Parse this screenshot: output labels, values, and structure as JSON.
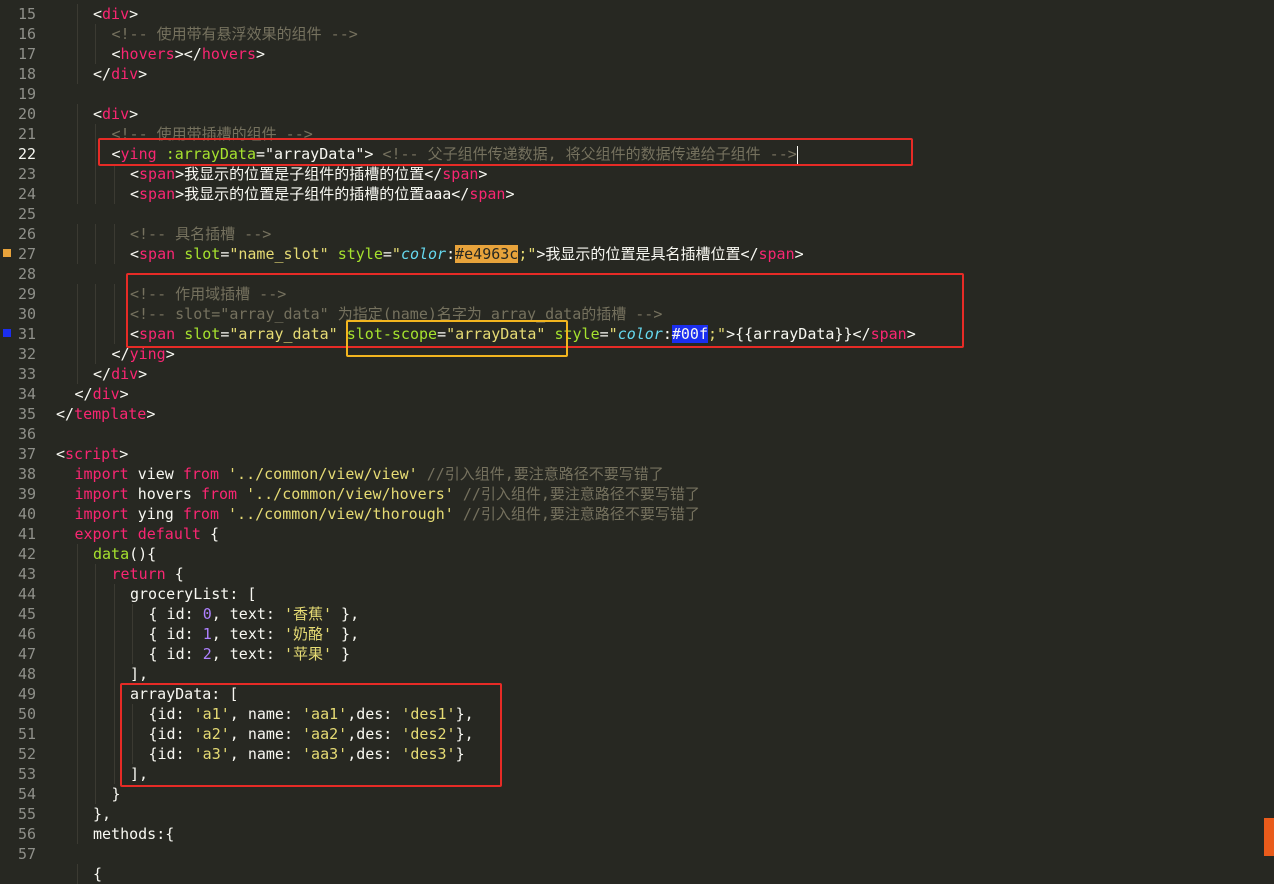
{
  "editor": {
    "active_line": "22",
    "lines": [
      {
        "n": "15",
        "indent": 2,
        "tokens": [
          [
            "<",
            "t-default"
          ],
          [
            "div",
            "t-tag"
          ],
          [
            ">",
            "t-default"
          ]
        ]
      },
      {
        "n": "16",
        "indent": 3,
        "tokens": [
          [
            "<!-- 使用带有悬浮效果的组件 -->",
            "t-com"
          ]
        ]
      },
      {
        "n": "17",
        "indent": 3,
        "tokens": [
          [
            "<",
            "t-default"
          ],
          [
            "hovers",
            "t-tag"
          ],
          [
            "></",
            "t-default"
          ],
          [
            "hovers",
            "t-tag"
          ],
          [
            ">",
            "t-default"
          ]
        ]
      },
      {
        "n": "18",
        "indent": 2,
        "tokens": [
          [
            "</",
            "t-default"
          ],
          [
            "div",
            "t-tag"
          ],
          [
            ">",
            "t-default"
          ]
        ]
      },
      {
        "n": "19",
        "indent": 0,
        "tokens": []
      },
      {
        "n": "20",
        "indent": 2,
        "tokens": [
          [
            "<",
            "t-default"
          ],
          [
            "div",
            "t-tag"
          ],
          [
            ">",
            "t-default"
          ]
        ]
      },
      {
        "n": "21",
        "indent": 3,
        "tokens": [
          [
            "<!-- 使用带插槽的组件 -->",
            "t-com"
          ]
        ]
      },
      {
        "n": "22",
        "indent": 3,
        "tokens": [
          [
            "<",
            "t-default"
          ],
          [
            "ying",
            "t-tag"
          ],
          [
            " ",
            "t-default"
          ],
          [
            ":arrayData",
            "t-attr"
          ],
          [
            "=",
            "t-default"
          ],
          [
            "\"arrayData\"",
            "t-default"
          ],
          [
            "> ",
            "t-default"
          ],
          [
            "<!-- 父子组件传递数据, 将父组件的数据传递给子组件 -->",
            "t-com"
          ],
          [
            "",
            "cursor"
          ]
        ]
      },
      {
        "n": "23",
        "indent": 4,
        "tokens": [
          [
            "<",
            "t-default"
          ],
          [
            "span",
            "t-tag"
          ],
          [
            ">我显示的位置是子组件的插槽的位置</",
            "t-default"
          ],
          [
            "span",
            "t-tag"
          ],
          [
            ">",
            "t-default"
          ]
        ]
      },
      {
        "n": "24",
        "indent": 4,
        "tokens": [
          [
            "<",
            "t-default"
          ],
          [
            "span",
            "t-tag"
          ],
          [
            ">我显示的位置是子组件的插槽的位置aaa</",
            "t-default"
          ],
          [
            "span",
            "t-tag"
          ],
          [
            ">",
            "t-default"
          ]
        ]
      },
      {
        "n": "25",
        "indent": 0,
        "tokens": []
      },
      {
        "n": "26",
        "indent": 4,
        "tokens": [
          [
            "<!-- 具名插槽 -->",
            "t-com"
          ]
        ]
      },
      {
        "n": "27",
        "indent": 4,
        "tokens": [
          [
            "<",
            "t-default"
          ],
          [
            "span",
            "t-tag"
          ],
          [
            " ",
            "t-default"
          ],
          [
            "slot",
            "t-attr"
          ],
          [
            "=",
            "t-default"
          ],
          [
            "\"name_slot\"",
            "t-str"
          ],
          [
            " ",
            "t-default"
          ],
          [
            "style",
            "t-attr"
          ],
          [
            "=",
            "t-default"
          ],
          [
            "\"",
            "t-str"
          ],
          [
            "color",
            "t-cssprop"
          ],
          [
            ":",
            "t-default"
          ],
          [
            "#e4963c",
            "hl-orange"
          ],
          [
            ";\"",
            "t-str"
          ],
          [
            ">我显示的位置是具名插槽位置</",
            "t-default"
          ],
          [
            "span",
            "t-tag"
          ],
          [
            ">",
            "t-default"
          ]
        ]
      },
      {
        "n": "28",
        "indent": 0,
        "tokens": []
      },
      {
        "n": "29",
        "indent": 4,
        "tokens": [
          [
            "<!-- 作用域插槽 -->",
            "t-com"
          ]
        ]
      },
      {
        "n": "30",
        "indent": 4,
        "tokens": [
          [
            "<!-- slot=\"array_data\" 为指定(name)名字为 array_data的插槽 -->",
            "t-com"
          ]
        ]
      },
      {
        "n": "31",
        "indent": 4,
        "tokens": [
          [
            "<",
            "t-default"
          ],
          [
            "span",
            "t-tag"
          ],
          [
            " ",
            "t-default"
          ],
          [
            "slot",
            "t-attr"
          ],
          [
            "=",
            "t-default"
          ],
          [
            "\"array_data\"",
            "t-str"
          ],
          [
            " ",
            "t-default"
          ],
          [
            "slot-scope",
            "t-attr"
          ],
          [
            "=",
            "t-default"
          ],
          [
            "\"arrayData\"",
            "t-str"
          ],
          [
            " ",
            "t-default"
          ],
          [
            "style",
            "t-attr"
          ],
          [
            "=",
            "t-default"
          ],
          [
            "\"",
            "t-str"
          ],
          [
            "color",
            "t-cssprop"
          ],
          [
            ":",
            "t-default"
          ],
          [
            "#00f",
            "hl-blue"
          ],
          [
            ";\"",
            "t-str"
          ],
          [
            ">{{arrayData}}</",
            "t-default"
          ],
          [
            "span",
            "t-tag"
          ],
          [
            ">",
            "t-default"
          ]
        ]
      },
      {
        "n": "32",
        "indent": 3,
        "tokens": [
          [
            "</",
            "t-default"
          ],
          [
            "ying",
            "t-tag"
          ],
          [
            ">",
            "t-default"
          ]
        ]
      },
      {
        "n": "33",
        "indent": 2,
        "tokens": [
          [
            "</",
            "t-default"
          ],
          [
            "div",
            "t-tag"
          ],
          [
            ">",
            "t-default"
          ]
        ]
      },
      {
        "n": "34",
        "indent": 1,
        "tokens": [
          [
            "</",
            "t-default"
          ],
          [
            "div",
            "t-tag"
          ],
          [
            ">",
            "t-default"
          ]
        ]
      },
      {
        "n": "35",
        "indent": 0,
        "tokens": [
          [
            "</",
            "t-default"
          ],
          [
            "template",
            "t-tag"
          ],
          [
            ">",
            "t-default"
          ]
        ]
      },
      {
        "n": "36",
        "indent": 0,
        "tokens": []
      },
      {
        "n": "37",
        "indent": 0,
        "tokens": [
          [
            "<",
            "t-default"
          ],
          [
            "script",
            "t-tag"
          ],
          [
            ">",
            "t-default"
          ]
        ]
      },
      {
        "n": "38",
        "indent": 1,
        "tokens": [
          [
            "import",
            "t-kw"
          ],
          [
            " view ",
            "t-default"
          ],
          [
            "from",
            "t-kw"
          ],
          [
            " ",
            "t-default"
          ],
          [
            "'../common/view/view'",
            "t-str"
          ],
          [
            " //引入组件,要注意路径不要写错了",
            "t-com"
          ]
        ]
      },
      {
        "n": "39",
        "indent": 1,
        "tokens": [
          [
            "import",
            "t-kw"
          ],
          [
            " hovers ",
            "t-default"
          ],
          [
            "from",
            "t-kw"
          ],
          [
            " ",
            "t-default"
          ],
          [
            "'../common/view/hovers'",
            "t-str"
          ],
          [
            " //引入组件,要注意路径不要写错了",
            "t-com"
          ]
        ]
      },
      {
        "n": "40",
        "indent": 1,
        "tokens": [
          [
            "import",
            "t-kw"
          ],
          [
            " ying ",
            "t-default"
          ],
          [
            "from",
            "t-kw"
          ],
          [
            " ",
            "t-default"
          ],
          [
            "'../common/view/thorough'",
            "t-str"
          ],
          [
            " //引入组件,要注意路径不要写错了",
            "t-com"
          ]
        ]
      },
      {
        "n": "41",
        "indent": 1,
        "tokens": [
          [
            "export",
            "t-kw"
          ],
          [
            " ",
            "t-default"
          ],
          [
            "default",
            "t-kw"
          ],
          [
            " {",
            "t-default"
          ]
        ]
      },
      {
        "n": "42",
        "indent": 2,
        "tokens": [
          [
            "data",
            "t-fn"
          ],
          [
            "(){",
            "t-default"
          ]
        ]
      },
      {
        "n": "43",
        "indent": 3,
        "tokens": [
          [
            "return",
            "t-kw"
          ],
          [
            " {",
            "t-default"
          ]
        ]
      },
      {
        "n": "44",
        "indent": 4,
        "tokens": [
          [
            "groceryList: [",
            "t-default"
          ]
        ]
      },
      {
        "n": "45",
        "indent": 5,
        "tokens": [
          [
            "{ id: ",
            "t-default"
          ],
          [
            "0",
            "t-num"
          ],
          [
            ", text: ",
            "t-default"
          ],
          [
            "'香蕉'",
            "t-str"
          ],
          [
            " },",
            "t-default"
          ]
        ]
      },
      {
        "n": "46",
        "indent": 5,
        "tokens": [
          [
            "{ id: ",
            "t-default"
          ],
          [
            "1",
            "t-num"
          ],
          [
            ", text: ",
            "t-default"
          ],
          [
            "'奶酪'",
            "t-str"
          ],
          [
            " },",
            "t-default"
          ]
        ]
      },
      {
        "n": "47",
        "indent": 5,
        "tokens": [
          [
            "{ id: ",
            "t-default"
          ],
          [
            "2",
            "t-num"
          ],
          [
            ", text: ",
            "t-default"
          ],
          [
            "'苹果'",
            "t-str"
          ],
          [
            " }",
            "t-default"
          ]
        ]
      },
      {
        "n": "48",
        "indent": 4,
        "tokens": [
          [
            "],",
            "t-default"
          ]
        ]
      },
      {
        "n": "49",
        "indent": 4,
        "tokens": [
          [
            "arrayData: [",
            "t-default"
          ]
        ]
      },
      {
        "n": "50",
        "indent": 5,
        "tokens": [
          [
            "{id: ",
            "t-default"
          ],
          [
            "'a1'",
            "t-str"
          ],
          [
            ", name: ",
            "t-default"
          ],
          [
            "'aa1'",
            "t-str"
          ],
          [
            ",des: ",
            "t-default"
          ],
          [
            "'des1'",
            "t-str"
          ],
          [
            "},",
            "t-default"
          ]
        ]
      },
      {
        "n": "51",
        "indent": 5,
        "tokens": [
          [
            "{id: ",
            "t-default"
          ],
          [
            "'a2'",
            "t-str"
          ],
          [
            ", name: ",
            "t-default"
          ],
          [
            "'aa2'",
            "t-str"
          ],
          [
            ",des: ",
            "t-default"
          ],
          [
            "'des2'",
            "t-str"
          ],
          [
            "},",
            "t-default"
          ]
        ]
      },
      {
        "n": "52",
        "indent": 5,
        "tokens": [
          [
            "{id: ",
            "t-default"
          ],
          [
            "'a3'",
            "t-str"
          ],
          [
            ", name: ",
            "t-default"
          ],
          [
            "'aa3'",
            "t-str"
          ],
          [
            ",des: ",
            "t-default"
          ],
          [
            "'des3'",
            "t-str"
          ],
          [
            "}",
            "t-default"
          ]
        ]
      },
      {
        "n": "53",
        "indent": 4,
        "tokens": [
          [
            "],",
            "t-default"
          ]
        ]
      },
      {
        "n": "54",
        "indent": 3,
        "tokens": [
          [
            "}",
            "t-default"
          ]
        ]
      },
      {
        "n": "55",
        "indent": 2,
        "tokens": [
          [
            "},",
            "t-default"
          ]
        ]
      },
      {
        "n": "56",
        "indent": 2,
        "tokens": [
          [
            "methods:{",
            "t-default"
          ]
        ]
      },
      {
        "n": "57",
        "indent": 0,
        "tokens": []
      },
      {
        "n": "",
        "indent": 2,
        "tokens": [
          [
            "{",
            "t-default"
          ]
        ]
      }
    ]
  },
  "colors": {
    "background": "#272822",
    "annotation_red": "#e62b26",
    "annotation_yellow": "#f2b51f",
    "line_marker_orange": "#e8a33b",
    "line_marker_blue": "#1b2ef0"
  }
}
